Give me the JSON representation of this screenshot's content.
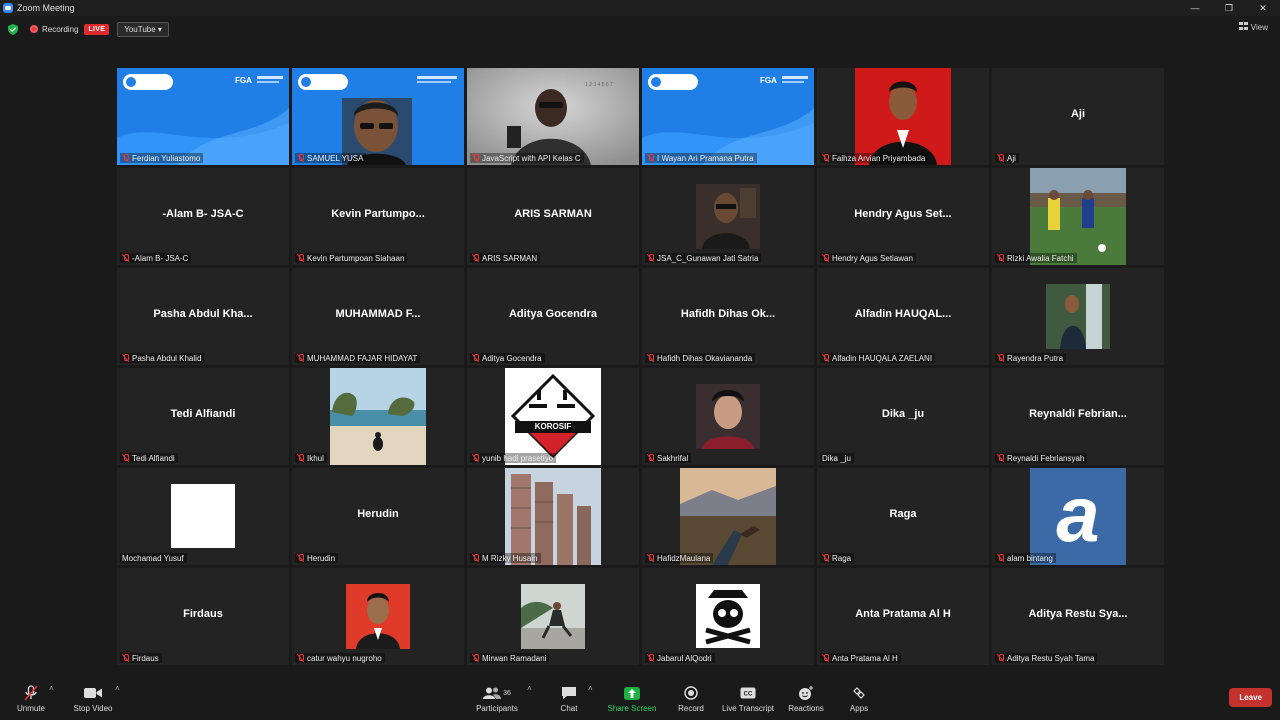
{
  "window": {
    "title": "Zoom Meeting",
    "controls": [
      "—",
      "❐",
      "✕"
    ]
  },
  "topbar": {
    "recording_label": "Recording",
    "live_label": "LIVE",
    "stream_target": "YouTube",
    "view_label": "View"
  },
  "tiles": [
    {
      "name": "Ferdian Yuliastomo",
      "bigname": "",
      "kind": "slide"
    },
    {
      "name": "SAMUEL YUSA",
      "bigname": "",
      "kind": "slide-face"
    },
    {
      "name": "JavaScript with API Kelas C",
      "bigname": "",
      "kind": "webcam",
      "active": true
    },
    {
      "name": "I Wayan Ari Pramana Putra",
      "bigname": "",
      "kind": "slide"
    },
    {
      "name": "Faihza Arvian Priyambada",
      "bigname": "",
      "kind": "redportrait"
    },
    {
      "name": "Aji",
      "bigname": "Aji",
      "kind": "text"
    },
    {
      "name": "-Alam B- JSA-C",
      "bigname": "-Alam B- JSA-C",
      "kind": "text"
    },
    {
      "name": "Kevin Partumpoan Siahaan",
      "bigname": "Kevin Partumpo...",
      "kind": "text"
    },
    {
      "name": "ARIS SARMAN",
      "bigname": "ARIS SARMAN",
      "kind": "text"
    },
    {
      "name": "JSA_C_Gunawan Jati Satria",
      "bigname": "",
      "kind": "darkphoto"
    },
    {
      "name": "Hendry Agus Setiawan",
      "bigname": "Hendry Agus Set...",
      "kind": "text"
    },
    {
      "name": "Rizki Awalia Fatchi",
      "bigname": "",
      "kind": "football"
    },
    {
      "name": "Pasha Abdul Khalid",
      "bigname": "Pasha Abdul Kha...",
      "kind": "text"
    },
    {
      "name": "MUHAMMAD FAJAR HIDAYAT",
      "bigname": "MUHAMMAD F...",
      "kind": "text"
    },
    {
      "name": "Aditya Gocendra",
      "bigname": "Aditya Gocendra",
      "kind": "text"
    },
    {
      "name": "Hafidh Dihas Okaviananda",
      "bigname": "Hafidh Dihas Ok...",
      "kind": "text"
    },
    {
      "name": "Alfadin HAUQALA ZAELANI",
      "bigname": "Alfadin HAUQAL...",
      "kind": "text"
    },
    {
      "name": "Rayendra Putra",
      "bigname": "",
      "kind": "waterfall"
    },
    {
      "name": "Tedi Alfiandi",
      "bigname": "Tedi Alfiandi",
      "kind": "text"
    },
    {
      "name": "Ikhul",
      "bigname": "",
      "kind": "beach"
    },
    {
      "name": "yunib hadi prasetiyo",
      "bigname": "",
      "kind": "korosif",
      "sign": "KOROSIF"
    },
    {
      "name": "Sakhrifal",
      "bigname": "",
      "kind": "selfie"
    },
    {
      "name": "Dika _ju",
      "bigname": "Dika _ju",
      "kind": "text",
      "nomute": true
    },
    {
      "name": "Reynaldi Febriansyah",
      "bigname": "Reynaldi Febrian...",
      "kind": "text"
    },
    {
      "name": "Mochamad Yusuf",
      "bigname": "",
      "kind": "white",
      "nomute": true
    },
    {
      "name": "Herudin",
      "bigname": "Herudin",
      "kind": "text"
    },
    {
      "name": "M Rizky Husain",
      "bigname": "",
      "kind": "ruins"
    },
    {
      "name": "HafidzMaulana",
      "bigname": "",
      "kind": "mountain"
    },
    {
      "name": "Raga",
      "bigname": "Raga",
      "kind": "text"
    },
    {
      "name": "alam bintang",
      "bigname": "",
      "kind": "logo-a",
      "glyph": "a"
    },
    {
      "name": "Firdaus",
      "bigname": "Firdaus",
      "kind": "text"
    },
    {
      "name": "catur wahyu nugroho",
      "bigname": "",
      "kind": "redportrait2"
    },
    {
      "name": "Mirwan Ramadani",
      "bigname": "",
      "kind": "skate"
    },
    {
      "name": "Jabarul AlQodri",
      "bigname": "",
      "kind": "skull"
    },
    {
      "name": "Anta Pratama Al H",
      "bigname": "Anta Pratama Al H",
      "kind": "text"
    },
    {
      "name": "Aditya Restu Syah Tama",
      "bigname": "Aditya Restu Sya...",
      "kind": "text"
    }
  ],
  "toolbar": {
    "unmute": "Unmute",
    "stop_video": "Stop Video",
    "participants": "Participants",
    "participant_count": "36",
    "chat": "Chat",
    "share_screen": "Share Screen",
    "record": "Record",
    "live_transcript": "Live Transcript",
    "reactions": "Reactions",
    "apps": "Apps",
    "leave": "Leave"
  },
  "colors": {
    "accent_blue": "#2d8cff",
    "live_red": "#e02a2f",
    "active_speaker": "#e6e43a",
    "share_green": "#1fb141",
    "leave_red": "#c5322e"
  }
}
